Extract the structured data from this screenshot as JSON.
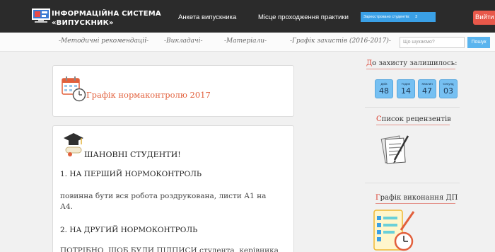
{
  "header": {
    "brand_line1": "ІНФОРМАЦІЙНА СИСТЕМА",
    "brand_line2": "«ВИПУСКНИК»",
    "nav": [
      {
        "label": "Анкета випускника"
      },
      {
        "label": "Місце проходження практики"
      }
    ],
    "registered_label": "Зареєстровано студентів:",
    "registered_count": "3",
    "logout_label": "Вийти"
  },
  "subnav": {
    "links": [
      {
        "label": "-Методичні рекомендації-"
      },
      {
        "label": "-Викладачі-"
      },
      {
        "label": "-Матеріали-"
      },
      {
        "label": "-Графік захистів (2016-2017)-"
      }
    ],
    "search_placeholder": "Що шукаємо?",
    "search_button": "Пошук"
  },
  "main": {
    "card1_title": "Графік нормаконтролю 2017",
    "greeting": "ШАНОВНІ СТУДЕНТИ!",
    "section1_heading": "1. НА ПЕРШИЙ НОРМОКОНТРОЛЬ",
    "section1_line1": "повинна бути вся робота роздрукована, листи А1 на",
    "section1_line2": "А4.",
    "section2_heading": "2. НА ДРУГИЙ НОРМОКОНТРОЛЬ",
    "section2_line1": "ПОТРІБНО, ЩОБ БУЛИ ПІДПИСИ студента, керівника"
  },
  "sidebar": {
    "countdown_first": "Д",
    "countdown_rest": "о захисту залишилось:",
    "countdown": [
      {
        "label": "Днів",
        "value": "48"
      },
      {
        "label": "Годин",
        "value": "14"
      },
      {
        "label": "Хвилин",
        "value": "47"
      },
      {
        "label": "Секунд",
        "value": "03"
      }
    ],
    "reviewers_first": "С",
    "reviewers_rest": "писок рецензентів",
    "schedule_first": "Г",
    "schedule_rest": "рафік виконання ДП"
  },
  "colors": {
    "header_bg": "#2b2b2b",
    "accent_orange": "#e2603c",
    "accent_red": "#d83a2a",
    "countdown_blue": "#76c0f2",
    "logout_red": "#e8584a",
    "badge_blue": "#3aa0e6"
  }
}
